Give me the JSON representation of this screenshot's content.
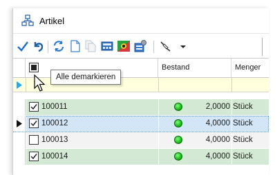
{
  "window": {
    "title": "Artikel"
  },
  "toolbar": {
    "icons": [
      "check-icon",
      "undo-icon",
      "refresh-icon",
      "new-document-icon",
      "copy-icon",
      "calculator-icon",
      "color-palette-icon",
      "properties-icon",
      "pin-icon",
      "dropdown-arrow-icon"
    ]
  },
  "grid": {
    "columns": [
      "",
      "Bestand",
      "Menger"
    ],
    "header_checkbox_tooltip": "Alle demarkieren",
    "rows": [
      {
        "checked": true,
        "id": "100011",
        "stock_status": "green",
        "quantity": "2,0000",
        "unit": "Stück",
        "current": false
      },
      {
        "checked": true,
        "id": "100012",
        "stock_status": "green",
        "quantity": "4,0000",
        "unit": "Stück",
        "current": true
      },
      {
        "checked": false,
        "id": "100013",
        "stock_status": "green",
        "quantity": "4,0000",
        "unit": "Stück",
        "current": false
      },
      {
        "checked": true,
        "id": "100014",
        "stock_status": "green",
        "quantity": "4,0000",
        "unit": "Stück",
        "current": false
      }
    ]
  },
  "colors": {
    "row_default": "#d4e9d4",
    "row_selected": "#d3e6f7",
    "row_unchecked": "#f3f3f3",
    "filter_row": "#ffffde",
    "accent": "#1e7bd6"
  }
}
